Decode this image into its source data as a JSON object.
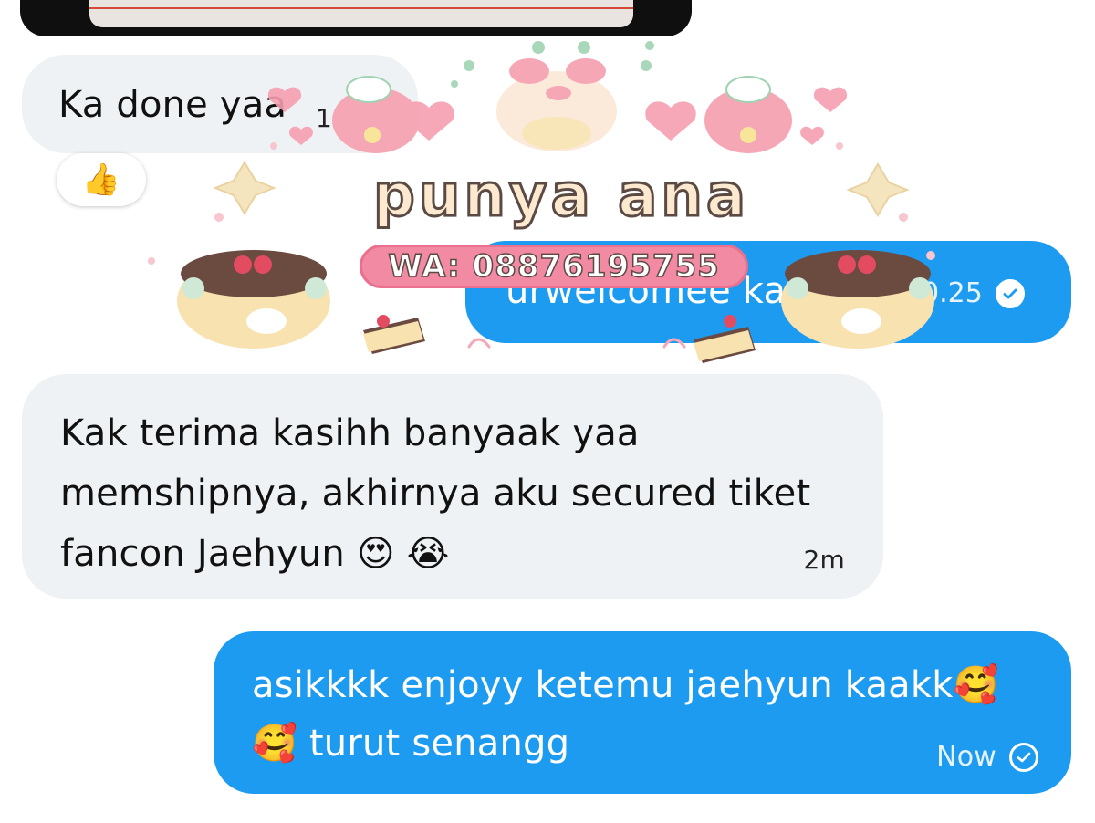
{
  "messages": [
    {
      "direction": "incoming",
      "text": "Ka done yaa",
      "time": "10",
      "reaction": "👍"
    },
    {
      "direction": "outgoing",
      "text": "urwelcomee ka",
      "time": "0.25",
      "status": "read"
    },
    {
      "direction": "incoming",
      "lines": [
        "Kak terima kasihh banyaak yaa",
        "memshipnya, akhirnya aku secured tiket",
        "fancon Jaehyun 😍 😭"
      ],
      "time": "2m"
    },
    {
      "direction": "outgoing",
      "lines": [
        "asikkkk enjoyy ketemu jaehyun kaakk🥰",
        "🥰 turut senangg"
      ],
      "time": "Now",
      "status": "sent"
    }
  ],
  "watermark": {
    "title": "punya ana",
    "phone": "WA: 08876195755"
  },
  "colors": {
    "outgoing_bubble": "#1d9bf0",
    "incoming_bubble": "#eff2f4",
    "watermark_pink": "#f28aa3",
    "watermark_cream": "#fde9cf"
  },
  "icons": [
    "read-check-icon",
    "sent-check-icon",
    "thumbs-up-reaction"
  ]
}
